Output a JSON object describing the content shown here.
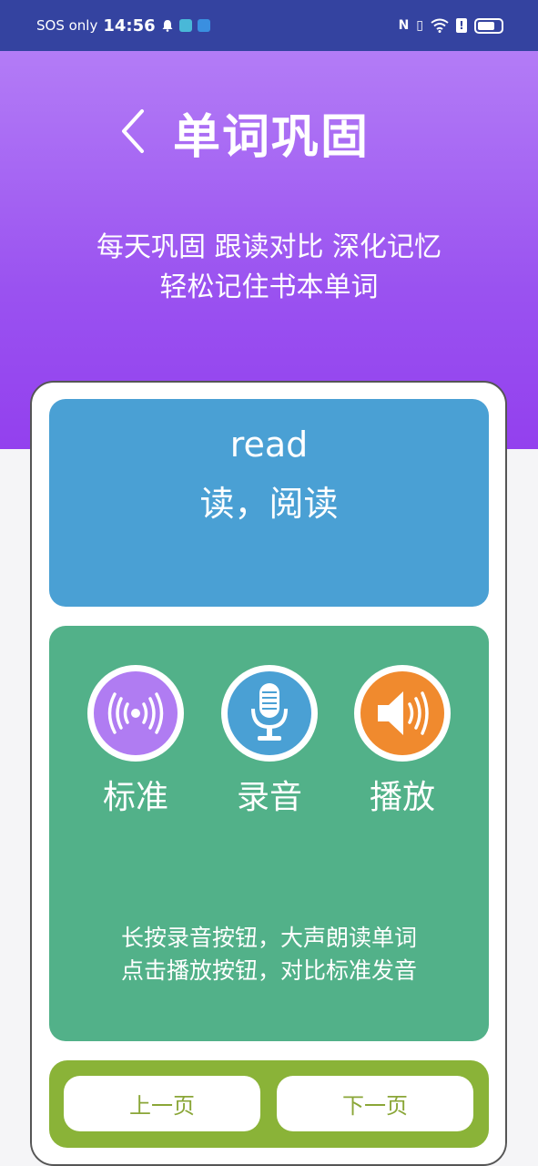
{
  "status_bar": {
    "carrier": "SOS only",
    "time": "14:56"
  },
  "header": {
    "title": "单词巩固",
    "subtitle_line1": "每天巩固  跟读对比  深化记忆",
    "subtitle_line2": "轻松记住书本单词"
  },
  "word_card": {
    "word": "read",
    "meaning": "读，阅读"
  },
  "actions": {
    "standard_label": "标准",
    "record_label": "录音",
    "play_label": "播放",
    "hint_line1": "长按录音按钮，大声朗读单词",
    "hint_line2": "点击播放按钮，对比标准发音"
  },
  "navigation": {
    "prev_label": "上一页",
    "next_label": "下一页"
  },
  "colors": {
    "header_top": "#b37cf6",
    "header_bottom": "#9340ee",
    "word_panel": "#4aa0d4",
    "action_panel": "#52b189",
    "nav_panel": "#8ab338",
    "standard_button": "#b07cf2",
    "record_button": "#4aa0d4",
    "play_button": "#f08a2e"
  },
  "icons": {
    "back": "chevron-left-icon",
    "standard": "broadcast-icon",
    "record": "microphone-icon",
    "play": "speaker-icon"
  }
}
